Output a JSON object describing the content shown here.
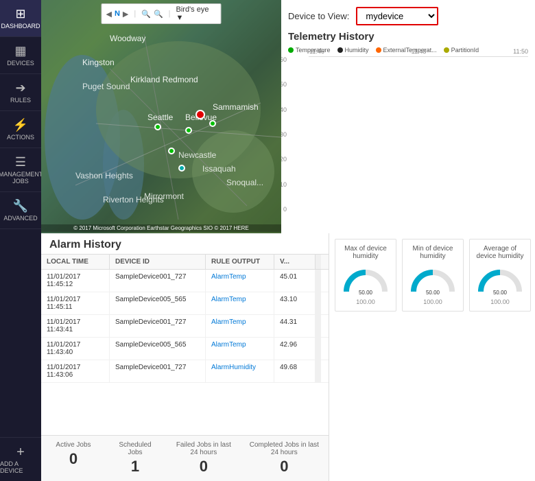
{
  "sidebar": {
    "items": [
      {
        "label": "DASHBOARD",
        "icon": "⊞"
      },
      {
        "label": "DEVICES",
        "icon": "📱"
      },
      {
        "label": "RULES",
        "icon": "→"
      },
      {
        "label": "ACTIONS",
        "icon": "⚡"
      },
      {
        "label": "MANAGEMENT JOBS",
        "icon": "📋"
      },
      {
        "label": "ADVANCED",
        "icon": "🔧"
      }
    ],
    "add_label": "ADD A DEVICE",
    "add_icon": "+"
  },
  "map": {
    "toolbar": {
      "nav_icon": "N",
      "zoom_in": "+",
      "zoom_out": "−",
      "pan": "✋",
      "birdseye": "Bird's eye ▼"
    },
    "copyright": "© 2017 Microsoft Corporation  Earthstar Geographics SIO © 2017 HERE"
  },
  "telemetry": {
    "device_label": "Device to View:",
    "device_value": "mydevice",
    "title": "Telemetry History",
    "legend": [
      {
        "label": "Temperature",
        "color": "#00aa00"
      },
      {
        "label": "Humidity",
        "color": "#222222"
      },
      {
        "label": "ExternalTemperat...",
        "color": "#ff6600"
      },
      {
        "label": "PartitionId",
        "color": "#aaaa00"
      }
    ],
    "y_labels": [
      "60",
      "50",
      "40",
      "30",
      "20",
      "10",
      "0"
    ],
    "x_labels": [
      "11:46",
      "11:48",
      "11:50"
    ],
    "lines": [
      {
        "color": "#e00000",
        "y_pct": 18
      },
      {
        "color": "#006060",
        "y_pct": 30
      }
    ]
  },
  "alarm": {
    "title": "Alarm History",
    "columns": [
      "LOCAL TIME",
      "DEVICE ID",
      "RULE OUTPUT",
      "V..."
    ],
    "rows": [
      {
        "time": "11/01/2017\n11:45:12",
        "device": "SampleDevice001_727",
        "rule": "AlarmTemp",
        "value": "45.01"
      },
      {
        "time": "11/01/2017\n11:45:11",
        "device": "SampleDevice005_565",
        "rule": "AlarmTemp",
        "value": "43.10"
      },
      {
        "time": "11/01/2017\n11:43:41",
        "device": "SampleDevice001_727",
        "rule": "AlarmTemp",
        "value": "44.31"
      },
      {
        "time": "11/01/2017\n11:43:40",
        "device": "SampleDevice005_565",
        "rule": "AlarmTemp",
        "value": "42.96"
      },
      {
        "time": "11/01/2017\n11:43:06",
        "device": "SampleDevice001_727",
        "rule": "AlarmHumidity",
        "value": "49.68"
      }
    ]
  },
  "jobs": {
    "items": [
      {
        "label": "Active Jobs",
        "count": "0"
      },
      {
        "label": "Scheduled Jobs",
        "count": "1"
      },
      {
        "label": "Failed Jobs in last 24 hours",
        "count": "0"
      },
      {
        "label": "Completed Jobs in last 24 hours",
        "count": "0"
      }
    ]
  },
  "humidity": {
    "cards": [
      {
        "title": "Max of device humidity",
        "value": "100.00",
        "gauge_val": 0.5
      },
      {
        "title": "Min of device humidity",
        "value": "100.00",
        "gauge_val": 0.5
      },
      {
        "title": "Average of device humidity",
        "value": "100.00",
        "gauge_val": 0.5
      }
    ]
  }
}
